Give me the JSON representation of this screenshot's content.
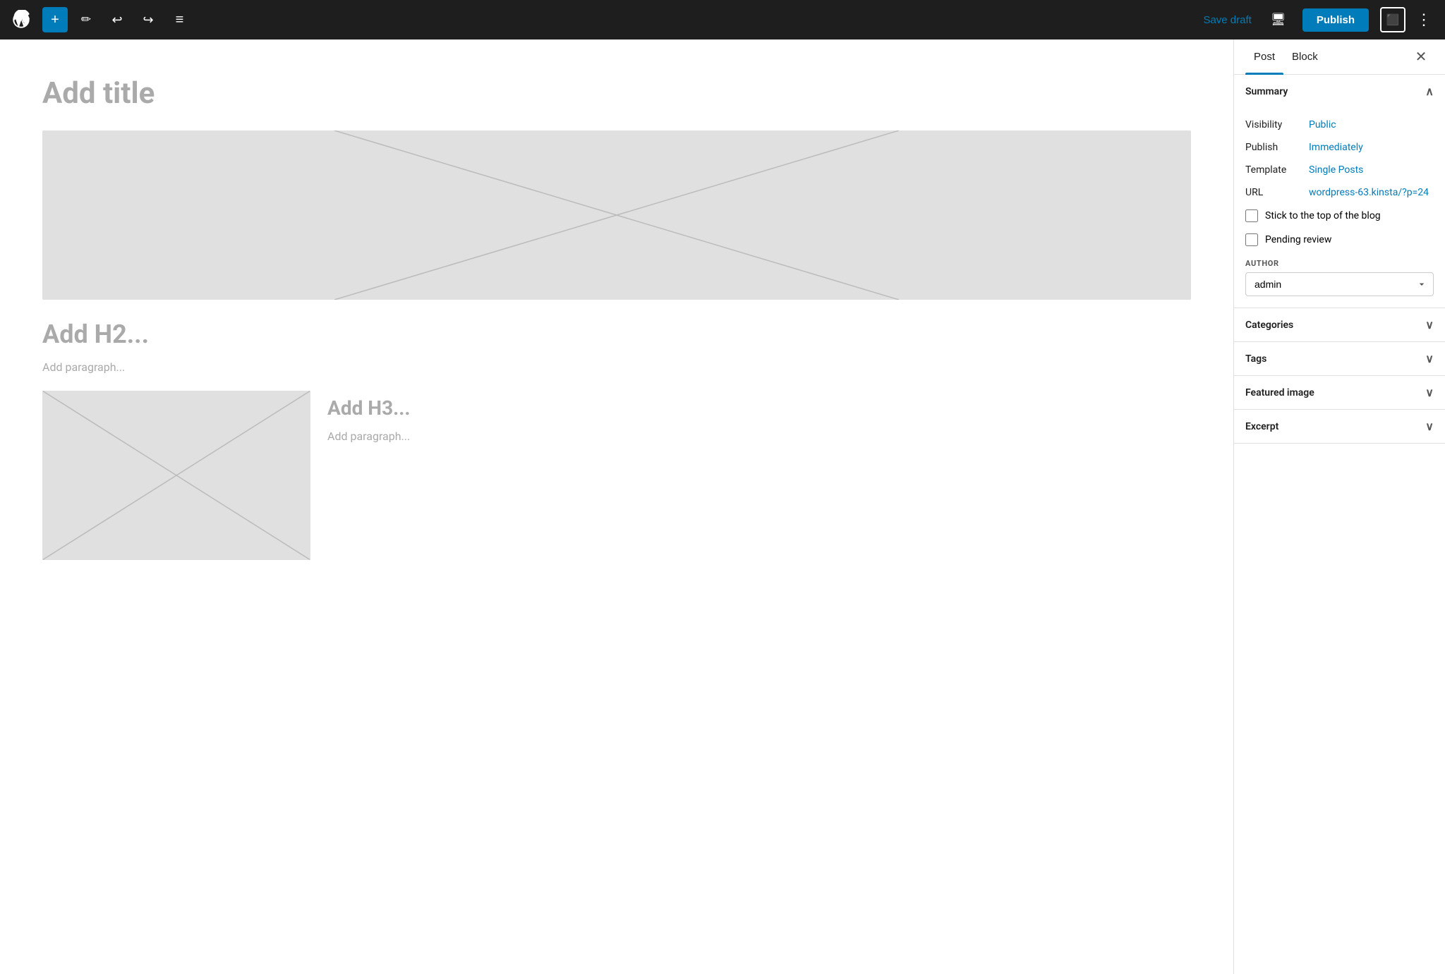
{
  "toolbar": {
    "add_label": "+",
    "save_draft_label": "Save draft",
    "publish_label": "Publish"
  },
  "editor": {
    "title_placeholder": "Add title",
    "h2_placeholder": "Add H2...",
    "paragraph_placeholder": "Add paragraph...",
    "h3_placeholder": "Add H3...",
    "paragraph2_placeholder": "Add paragraph..."
  },
  "sidebar": {
    "post_tab": "Post",
    "block_tab": "Block",
    "summary_heading": "Summary",
    "visibility_label": "Visibility",
    "visibility_value": "Public",
    "publish_label": "Publish",
    "publish_value": "Immediately",
    "template_label": "Template",
    "template_value": "Single Posts",
    "url_label": "URL",
    "url_value": "wordpress-63.kinsta/?p=24",
    "stick_to_top_label": "Stick to the top of the blog",
    "pending_review_label": "Pending review",
    "author_label": "AUTHOR",
    "author_value": "admin",
    "categories_heading": "Categories",
    "tags_heading": "Tags",
    "featured_image_heading": "Featured image",
    "excerpt_heading": "Excerpt"
  }
}
